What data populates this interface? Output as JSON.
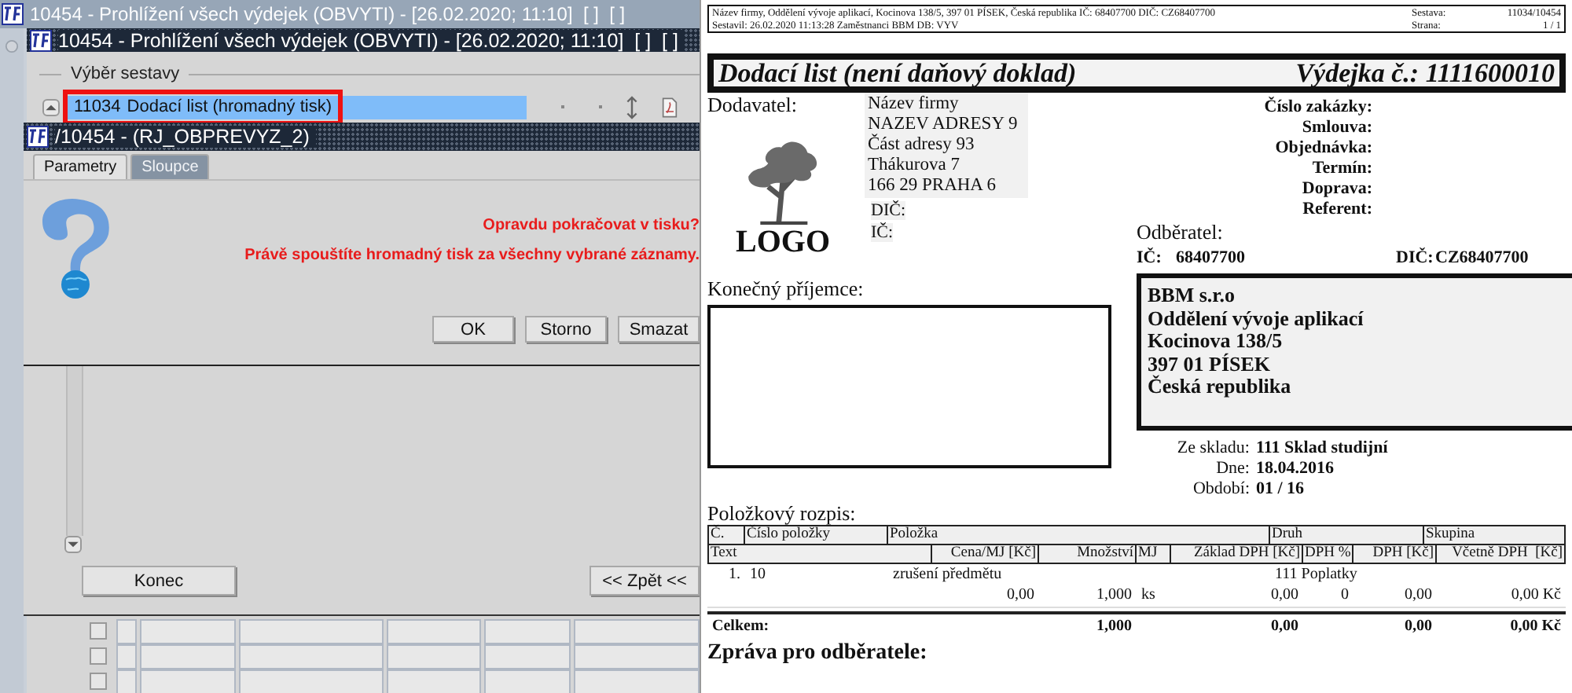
{
  "background_window": {
    "title": "10454 - Prohlížení všech výdejek (OBVYTI) - [26.02.2020; 11:10]  [ ]  [ ]"
  },
  "main_window": {
    "title": "10454 - Prohlížení všech výdejek (OBVYTI) - [26.02.2020; 11:10]  [ ]  [ ]",
    "section_label": "Výběr sestavy",
    "report_row": {
      "code": "11034",
      "name": "Dodací list (hromadný tisk)",
      "selected": true,
      "highlighted": true
    },
    "grid_rows": [
      {
        "checked": false
      },
      {
        "checked": false
      },
      {
        "checked": false
      }
    ]
  },
  "dialog": {
    "title": "/10454 - (RJ_OBPREVYZ_2)",
    "tabs": [
      {
        "label": "Parametry",
        "selected": true
      },
      {
        "label": "Sloupce",
        "selected": false
      }
    ],
    "question": "Opravdu pokračovat v tisku?",
    "message": "Právě spouštíte hromadný tisk za všechny vybrané záznamy.",
    "buttons": [
      "OK",
      "Storno",
      "Smazat"
    ],
    "bottom_buttons": [
      "Konec",
      "<< Zpět <<"
    ]
  },
  "document": {
    "header": {
      "line_1": "Název firmy, Oddělení vývoje aplikací, Kocinova 138/5, 397 01 PÍSEK, Česká republika  IČ: 68407700  DIČ: CZ68407700",
      "line_2": "Sestavil: 26.02.2020 11:13:28 Zaměstnanci BBM  DB: VYV",
      "fields": [
        {
          "label": "Sestava:",
          "value": "11034/10454"
        },
        {
          "label": "Strana:",
          "value": "1 / 1"
        }
      ]
    },
    "title": "Dodací list (není daňový doklad)",
    "number": "Výdejka č.: 1111600010",
    "supplier": {
      "label": "Dodavatel:",
      "logo_text": "LOGO",
      "address": [
        "Název firmy",
        "NAZEV ADRESY 9",
        "Část adresy 93",
        "Thákurova 7",
        "166 29 PRAHA 6"
      ],
      "dic_label": "DIČ:",
      "ic_label": "IČ:"
    },
    "order_fields": [
      "Číslo zakázky:",
      "Smlouva:",
      "Objednávka:",
      "Termín:",
      "Doprava:",
      "Referent:"
    ],
    "customer": {
      "label": "Odběratel:",
      "ic_label": "IČ:",
      "ic": "68407700",
      "dic_label": "DIČ:",
      "dic": "CZ68407700",
      "address": [
        "BBM s.r.o",
        "Oddělení vývoje aplikací",
        "Kocinova 138/5",
        "397 01 PÍSEK",
        "Česká republika"
      ]
    },
    "final_recipient": {
      "label": "Konečný příjemce:"
    },
    "warehouse": [
      {
        "label": "Ze skladu:",
        "value": "111 Sklad studijní"
      },
      {
        "label": "Dne:",
        "value": "18.04.2016"
      },
      {
        "label": "Období:",
        "value": "01 / 16"
      }
    ],
    "items": {
      "label": "Položkový rozpis:",
      "header_row_1": [
        "Č.",
        "Číslo položky",
        "Položka",
        "Druh",
        "Skupina"
      ],
      "header_row_2": [
        "Text",
        "Cena/MJ [Kč]",
        "Množství",
        "MJ",
        "Základ DPH [Kč]",
        "DPH %",
        "DPH [Kč]",
        "Včetně DPH  [Kč]"
      ],
      "rows": [
        {
          "number": "1.",
          "code": "10",
          "name": "zrušení předmětu",
          "type": "111 Poplatky",
          "price": "0,00",
          "quantity": "1,000",
          "unit": "ks",
          "base": "0,00",
          "vat_rate": "0",
          "vat": "0,00",
          "total": "0,00 Kč"
        }
      ],
      "total": {
        "label": "Celkem:",
        "quantity": "1,000",
        "base": "0,00",
        "vat": "0,00",
        "total": "0,00 Kč"
      }
    },
    "message_label": "Zpráva pro odběratele:"
  }
}
